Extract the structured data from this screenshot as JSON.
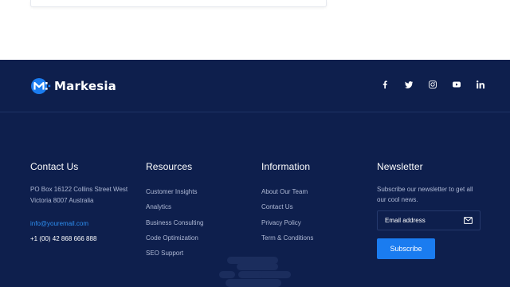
{
  "brand": {
    "name": "Markesia",
    "logo_icon": "markesia-logo-icon",
    "logo_colors": [
      "#1a7cf0",
      "#ffffff"
    ]
  },
  "social": [
    {
      "icon": "facebook-icon"
    },
    {
      "icon": "twitter-icon"
    },
    {
      "icon": "instagram-icon"
    },
    {
      "icon": "youtube-icon"
    },
    {
      "icon": "linkedin-icon"
    }
  ],
  "contact": {
    "heading": "Contact Us",
    "address_line1": "PO Box 16122 Collins Street West",
    "address_line2": "Victoria 8007 Australia",
    "email": "info@youremail.com",
    "phone": "+1 (00) 42 868 666 888"
  },
  "resources": {
    "heading": "Resources",
    "items": [
      "Customer Insights",
      "Analytics",
      "Business Consulting",
      "Code Optimization",
      "SEO Support"
    ]
  },
  "information": {
    "heading": "Information",
    "items": [
      "About Our Team",
      "Contact Us",
      "Privacy Policy",
      "Term & Conditions"
    ]
  },
  "newsletter": {
    "heading": "Newsletter",
    "text": "Subscribe our newsletter to get all our cool news.",
    "placeholder": "Email address",
    "button_label": "Subscribe",
    "input_icon": "envelope-icon"
  },
  "colors": {
    "footer_bg": "#0e1f4d",
    "accent": "#1a7cf0",
    "link": "#2e8ef0",
    "muted_text": "#aeb8d4"
  }
}
